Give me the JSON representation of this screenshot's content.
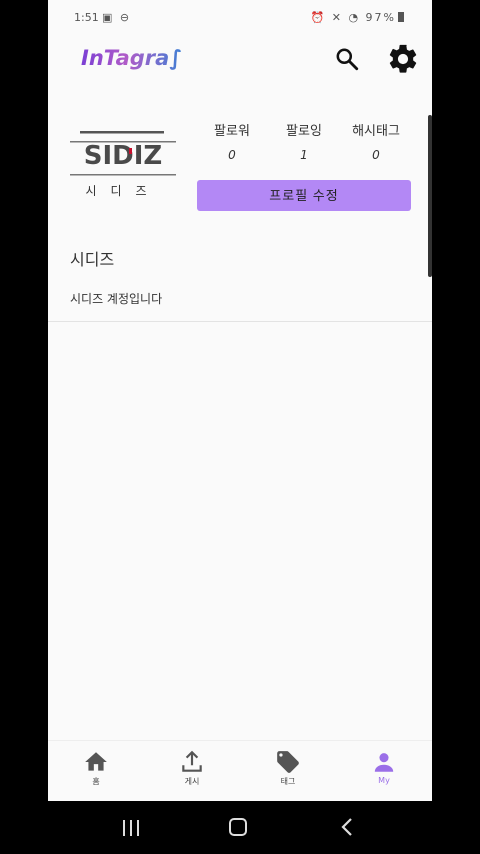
{
  "status_bar": {
    "time": "1:51",
    "left_icons": "▣ ⊖",
    "right_icons": "⏰ ✕ ◔",
    "battery": "97%"
  },
  "app": {
    "logo": "InTagra∫"
  },
  "profile": {
    "avatar_brand": "SIDIZ",
    "avatar_caption": "시디즈",
    "stats": [
      {
        "label": "팔로워",
        "value": "0"
      },
      {
        "label": "팔로잉",
        "value": "1"
      },
      {
        "label": "해시태그",
        "value": "0"
      }
    ],
    "edit_button_label": "프로필 수정",
    "display_name": "시디즈",
    "bio": "시디즈 계정입니다"
  },
  "bottom_nav": {
    "items": [
      {
        "label": "홈",
        "icon": "home-icon",
        "active": false
      },
      {
        "label": "게시",
        "icon": "upload-icon",
        "active": false
      },
      {
        "label": "태그",
        "icon": "tag-icon",
        "active": false
      },
      {
        "label": "My",
        "icon": "person-icon",
        "active": true
      }
    ]
  },
  "colors": {
    "accent": "#b388f5",
    "active_nav": "#9b6fe8",
    "brand_red": "#c8102e"
  }
}
